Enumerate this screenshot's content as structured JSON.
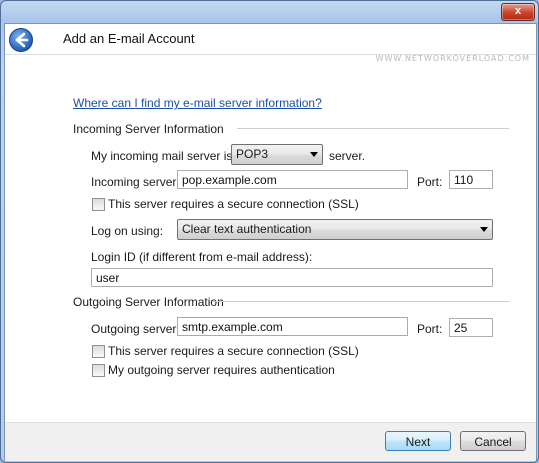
{
  "window": {
    "title": "Add an E-mail Account",
    "close_glyph": "x",
    "watermark": "WWW.NETWORKOVERLOAD.COM"
  },
  "help_link": "Where can I find my e-mail server information?",
  "incoming": {
    "section_title": "Incoming Server Information",
    "server_type_prefix": "My incoming mail server is a",
    "server_type_value": "POP3",
    "server_type_suffix": "server.",
    "server_label": "Incoming server:",
    "server_value": "pop.example.com",
    "port_label": "Port:",
    "port_value": "110",
    "ssl_label": "This server requires a secure connection (SSL)",
    "ssl_checked": false,
    "logon_label": "Log on using:",
    "logon_value": "Clear text authentication",
    "login_id_label": "Login ID (if different from e-mail address):",
    "login_id_value": "user"
  },
  "outgoing": {
    "section_title": "Outgoing Server Information",
    "server_label": "Outgoing server:",
    "server_value": "smtp.example.com",
    "port_label": "Port:",
    "port_value": "25",
    "ssl_label": "This server requires a secure connection (SSL)",
    "ssl_checked": false,
    "auth_label": "My outgoing server requires authentication",
    "auth_checked": false
  },
  "buttons": {
    "next": "Next",
    "cancel": "Cancel"
  },
  "icons": {
    "back": "back-arrow-icon",
    "close": "close-icon",
    "dropdown": "chevron-down-icon"
  }
}
